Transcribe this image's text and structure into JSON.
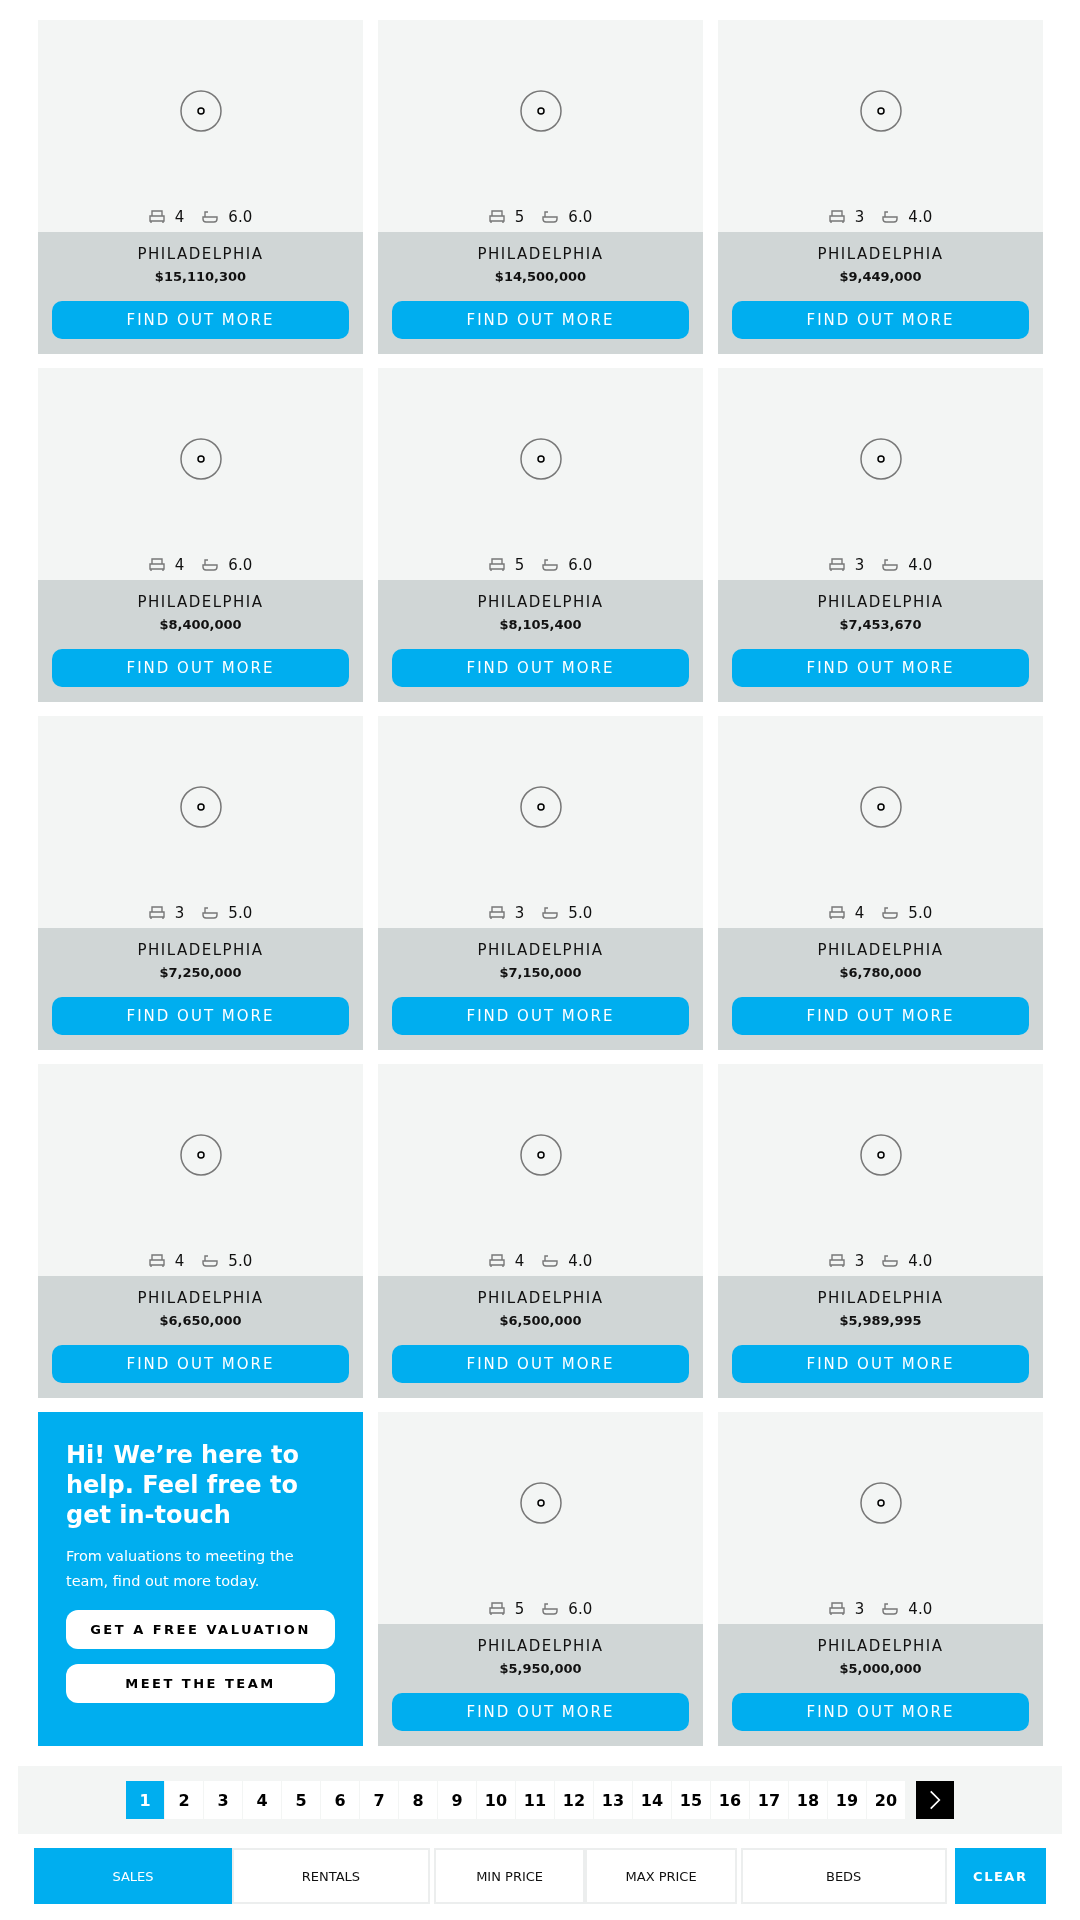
{
  "cards": [
    {
      "kind": "listing",
      "beds": "4",
      "baths": "6.0",
      "city": "PHILADELPHIA",
      "price": "$15,110,300",
      "button": "FIND OUT MORE"
    },
    {
      "kind": "listing",
      "beds": "5",
      "baths": "6.0",
      "city": "PHILADELPHIA",
      "price": "$14,500,000",
      "button": "FIND OUT MORE"
    },
    {
      "kind": "listing",
      "beds": "3",
      "baths": "4.0",
      "city": "PHILADELPHIA",
      "price": "$9,449,000",
      "button": "FIND OUT MORE"
    },
    {
      "kind": "listing",
      "beds": "4",
      "baths": "6.0",
      "city": "PHILADELPHIA",
      "price": "$8,400,000",
      "button": "FIND OUT MORE"
    },
    {
      "kind": "listing",
      "beds": "5",
      "baths": "6.0",
      "city": "PHILADELPHIA",
      "price": "$8,105,400",
      "button": "FIND OUT MORE"
    },
    {
      "kind": "listing",
      "beds": "3",
      "baths": "4.0",
      "city": "PHILADELPHIA",
      "price": "$7,453,670",
      "button": "FIND OUT MORE"
    },
    {
      "kind": "listing",
      "beds": "3",
      "baths": "5.0",
      "city": "PHILADELPHIA",
      "price": "$7,250,000",
      "button": "FIND OUT MORE"
    },
    {
      "kind": "listing",
      "beds": "3",
      "baths": "5.0",
      "city": "PHILADELPHIA",
      "price": "$7,150,000",
      "button": "FIND OUT MORE"
    },
    {
      "kind": "listing",
      "beds": "4",
      "baths": "5.0",
      "city": "PHILADELPHIA",
      "price": "$6,780,000",
      "button": "FIND OUT MORE"
    },
    {
      "kind": "listing",
      "beds": "4",
      "baths": "5.0",
      "city": "PHILADELPHIA",
      "price": "$6,650,000",
      "button": "FIND OUT MORE"
    },
    {
      "kind": "listing",
      "beds": "4",
      "baths": "4.0",
      "city": "PHILADELPHIA",
      "price": "$6,500,000",
      "button": "FIND OUT MORE"
    },
    {
      "kind": "listing",
      "beds": "3",
      "baths": "4.0",
      "city": "PHILADELPHIA",
      "price": "$5,989,995",
      "button": "FIND OUT MORE"
    },
    {
      "kind": "contact",
      "heading": "Hi! We’re here to help. Feel free to get in-touch",
      "text": "From valuations to meeting the team, find out more today.",
      "buttons": [
        "GET A FREE VALUATION",
        "MEET THE TEAM"
      ]
    },
    {
      "kind": "listing",
      "beds": "5",
      "baths": "6.0",
      "city": "PHILADELPHIA",
      "price": "$5,950,000",
      "button": "FIND OUT MORE"
    },
    {
      "kind": "listing",
      "beds": "3",
      "baths": "4.0",
      "city": "PHILADELPHIA",
      "price": "$5,000,000",
      "button": "FIND OUT MORE"
    }
  ],
  "pagination": {
    "pages": [
      {
        "label": "1",
        "selected": true
      },
      {
        "label": "2",
        "selected": false
      },
      {
        "label": "3",
        "selected": false
      },
      {
        "label": "4",
        "selected": false
      },
      {
        "label": "5",
        "selected": false
      },
      {
        "label": "6",
        "selected": false
      },
      {
        "label": "7",
        "selected": false
      },
      {
        "label": "8",
        "selected": false
      },
      {
        "label": "9",
        "selected": false
      },
      {
        "label": "10",
        "selected": false
      },
      {
        "label": "11",
        "selected": false
      },
      {
        "label": "12",
        "selected": false
      },
      {
        "label": "13",
        "selected": false
      },
      {
        "label": "14",
        "selected": false
      },
      {
        "label": "15",
        "selected": false
      },
      {
        "label": "16",
        "selected": false
      },
      {
        "label": "17",
        "selected": false
      },
      {
        "label": "18",
        "selected": false
      },
      {
        "label": "19",
        "selected": false
      },
      {
        "label": "20",
        "selected": false
      }
    ]
  },
  "filters": [
    {
      "label": "SALES",
      "kind": "tab",
      "selected": true
    },
    {
      "label": "RENTALS",
      "kind": "tab",
      "selected": false
    },
    {
      "label": "MIN PRICE",
      "kind": "dropdown"
    },
    {
      "label": "MAX PRICE",
      "kind": "dropdown"
    },
    {
      "label": "BEDS",
      "kind": "dropdown"
    },
    {
      "label": "CLEAR",
      "kind": "action"
    }
  ]
}
